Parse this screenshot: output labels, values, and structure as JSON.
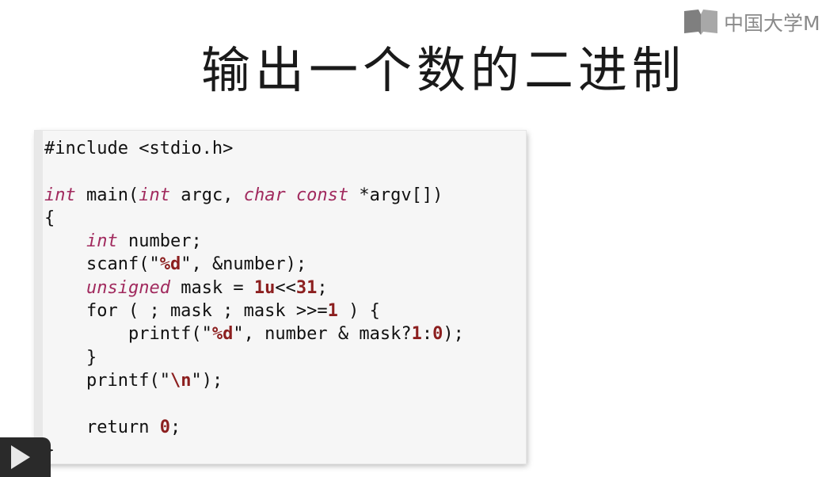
{
  "header": {
    "logo_icon": "book-icon",
    "logo_text": "中国大学M",
    "title": "输出一个数的二进制"
  },
  "code": {
    "language": "c",
    "colors": {
      "keyword": "#a12a5e",
      "number": "#8c1f1f",
      "text": "#111111"
    },
    "lines": [
      [
        {
          "t": "#include <stdio.h>",
          "c": "plain"
        }
      ],
      [],
      [
        {
          "t": "int",
          "c": "kw"
        },
        {
          "t": " main(",
          "c": "plain"
        },
        {
          "t": "int",
          "c": "kw"
        },
        {
          "t": " argc, ",
          "c": "plain"
        },
        {
          "t": "char",
          "c": "kw"
        },
        {
          "t": " ",
          "c": "plain"
        },
        {
          "t": "const",
          "c": "kw"
        },
        {
          "t": " *argv[])",
          "c": "plain"
        }
      ],
      [
        {
          "t": "{",
          "c": "plain"
        }
      ],
      [
        {
          "t": "    ",
          "c": "plain"
        },
        {
          "t": "int",
          "c": "kw"
        },
        {
          "t": " number;",
          "c": "plain"
        }
      ],
      [
        {
          "t": "    scanf(\"",
          "c": "plain"
        },
        {
          "t": "%d",
          "c": "fmt"
        },
        {
          "t": "\", &number);",
          "c": "plain"
        }
      ],
      [
        {
          "t": "    ",
          "c": "plain"
        },
        {
          "t": "unsigned",
          "c": "kw"
        },
        {
          "t": " mask = ",
          "c": "plain"
        },
        {
          "t": "1u",
          "c": "num"
        },
        {
          "t": "<<",
          "c": "plain"
        },
        {
          "t": "31",
          "c": "num"
        },
        {
          "t": ";",
          "c": "plain"
        }
      ],
      [
        {
          "t": "    for ( ; mask ; mask >>=",
          "c": "plain"
        },
        {
          "t": "1",
          "c": "num"
        },
        {
          "t": " ) {",
          "c": "plain"
        }
      ],
      [
        {
          "t": "        printf(\"",
          "c": "plain"
        },
        {
          "t": "%d",
          "c": "fmt"
        },
        {
          "t": "\", number & mask?",
          "c": "plain"
        },
        {
          "t": "1",
          "c": "num"
        },
        {
          "t": ":",
          "c": "plain"
        },
        {
          "t": "0",
          "c": "num"
        },
        {
          "t": ");",
          "c": "plain"
        }
      ],
      [
        {
          "t": "    }",
          "c": "plain"
        }
      ],
      [
        {
          "t": "    printf(\"",
          "c": "plain"
        },
        {
          "t": "\\n",
          "c": "fmt"
        },
        {
          "t": "\");",
          "c": "plain"
        }
      ],
      [],
      [
        {
          "t": "    return ",
          "c": "plain"
        },
        {
          "t": "0",
          "c": "num"
        },
        {
          "t": ";",
          "c": "plain"
        }
      ],
      [
        {
          "t": "}",
          "c": "plain"
        }
      ]
    ]
  },
  "player": {
    "play_icon": "play-icon"
  }
}
